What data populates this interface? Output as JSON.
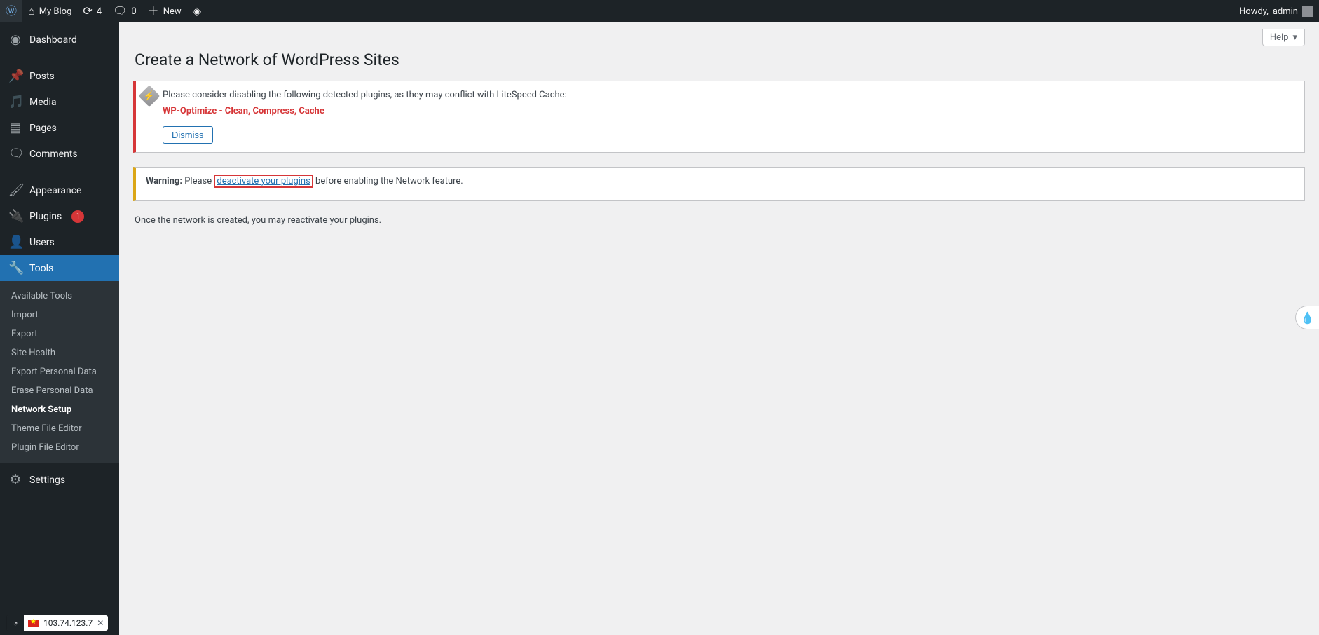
{
  "adminbar": {
    "site_name": "My Blog",
    "updates_count": "4",
    "comments_count": "0",
    "new_label": "New",
    "howdy_prefix": "Howdy, ",
    "user_name": "admin"
  },
  "menu": {
    "dashboard": "Dashboard",
    "posts": "Posts",
    "media": "Media",
    "pages": "Pages",
    "comments": "Comments",
    "appearance": "Appearance",
    "plugins": "Plugins",
    "plugins_badge": "1",
    "users": "Users",
    "tools": "Tools",
    "settings": "Settings"
  },
  "tools_submenu": {
    "available_tools": "Available Tools",
    "import": "Import",
    "export": "Export",
    "site_health": "Site Health",
    "export_personal": "Export Personal Data",
    "erase_personal": "Erase Personal Data",
    "network_setup": "Network Setup",
    "theme_file_editor": "Theme File Editor",
    "plugin_file_editor": "Plugin File Editor"
  },
  "help_tab": "Help",
  "page_title": "Create a Network of WordPress Sites",
  "ls_notice": {
    "intro": "Please consider disabling the following detected plugins, as they may conflict with LiteSpeed Cache:",
    "conflict_plugin": "WP-Optimize - Clean, Compress, Cache",
    "dismiss": "Dismiss"
  },
  "warning": {
    "label": "Warning:",
    "before": " Please ",
    "link_text": "deactivate your plugins",
    "after": " before enabling the Network feature."
  },
  "body_text": "Once the network is created, you may reactivate your plugins.",
  "ip_pill": {
    "ip": "103.74.123.7"
  }
}
